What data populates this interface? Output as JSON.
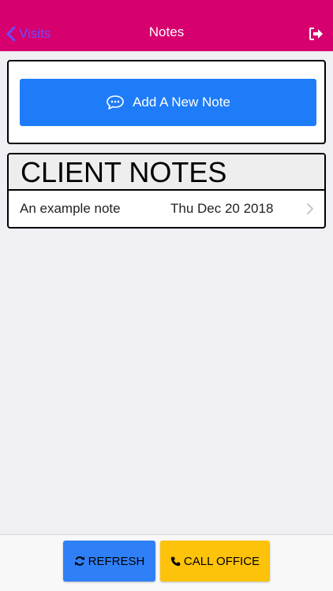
{
  "nav": {
    "back_label": "Visits",
    "title": "Notes",
    "back_icon": "chevron-left-icon",
    "logout_icon": "sign-out-icon"
  },
  "add_note": {
    "label": "Add A New Note",
    "icon": "comment-dots-icon"
  },
  "notes": {
    "header": "CLIENT NOTES",
    "items": [
      {
        "title": "An example note",
        "date": "Thu Dec 20 2018"
      }
    ]
  },
  "toolbar": {
    "refresh_label": "REFRESH",
    "call_label": "CALL OFFICE",
    "refresh_icon": "refresh-icon",
    "call_icon": "phone-icon"
  },
  "colors": {
    "nav_bg": "#d6006e",
    "accent_blue": "#1f7cf8",
    "refresh_bg": "#2f80f6",
    "call_bg": "#fdc20a",
    "back_text": "#6a4cff"
  }
}
